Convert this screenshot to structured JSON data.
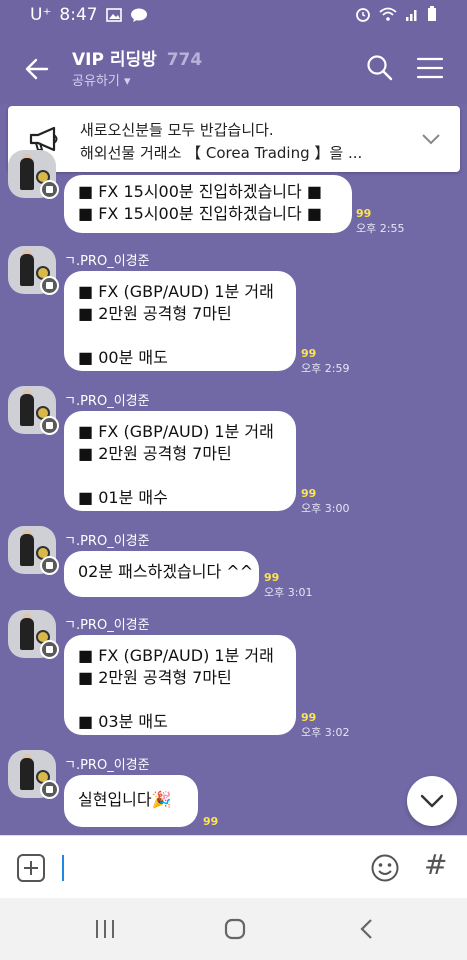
{
  "status_bar": {
    "carrier": "U⁺",
    "time": "8:47"
  },
  "header": {
    "title": "VIP 리딩방",
    "member_count": "774",
    "share_label": "공유하기 ▾"
  },
  "notice": {
    "line1": "새로오신분들 모두 반갑습니다.",
    "line2": "해외선물 거래소 【 Corea Trading 】을 ..."
  },
  "messages": [
    {
      "nickname": "",
      "lines": [
        "■ FX 15시00분 진입하겠습니다 ■",
        "■ FX 15시00분 진입하겠습니다 ■"
      ],
      "unread": "99",
      "time": "오후 2:55"
    },
    {
      "nickname": "ㄱ.PRO_이경준",
      "lines": [
        "■ FX (GBP/AUD) 1분 거래",
        "■ 2만원 공격형 7마틴",
        "",
        "■ 00분 매도"
      ],
      "unread": "99",
      "time": "오후 2:59"
    },
    {
      "nickname": "ㄱ.PRO_이경준",
      "lines": [
        "■ FX (GBP/AUD) 1분 거래",
        "■ 2만원 공격형 7마틴",
        "",
        "■ 01분 매수"
      ],
      "unread": "99",
      "time": "오후 3:00"
    },
    {
      "nickname": "ㄱ.PRO_이경준",
      "lines": [
        "02분 패스하겠습니다 ^^"
      ],
      "unread": "99",
      "time": "오후 3:01"
    },
    {
      "nickname": "ㄱ.PRO_이경준",
      "lines": [
        "■ FX (GBP/AUD) 1분 거래",
        "■ 2만원 공격형 7마틴",
        "",
        "■ 03분 매도"
      ],
      "unread": "99",
      "time": "오후 3:02"
    },
    {
      "nickname": "ㄱ.PRO_이경준",
      "lines": [
        "실현입니다🎉"
      ],
      "unread": "99",
      "time": ""
    }
  ],
  "input": {
    "placeholder": ""
  },
  "icons": {
    "back": "arrow-left-icon",
    "search": "search-icon",
    "menu": "hamburger-menu-icon",
    "notice": "megaphone-icon",
    "expand": "chevron-down-icon",
    "attach": "plus-box-icon",
    "emoji": "emoji-icon",
    "hashtag": "hash-icon"
  },
  "colors": {
    "chat_bg": "#7168a6",
    "unread": "#ffe44a",
    "bubble": "#ffffff"
  }
}
